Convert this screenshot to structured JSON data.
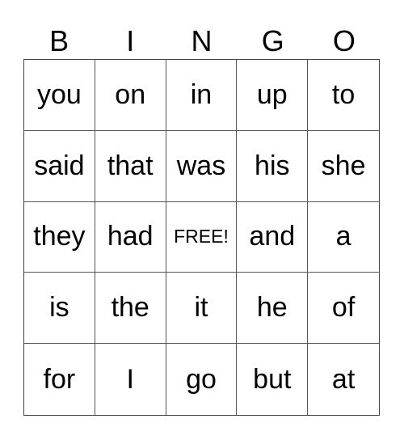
{
  "card": {
    "header": [
      "B",
      "I",
      "N",
      "G",
      "O"
    ],
    "rows": [
      [
        "you",
        "on",
        "in",
        "up",
        "to"
      ],
      [
        "said",
        "that",
        "was",
        "his",
        "she"
      ],
      [
        "they",
        "had",
        "FREE!",
        "and",
        "a"
      ],
      [
        "is",
        "the",
        "it",
        "he",
        "of"
      ],
      [
        "for",
        "I",
        "go",
        "but",
        "at"
      ]
    ],
    "free_space_label": "FREE!"
  }
}
